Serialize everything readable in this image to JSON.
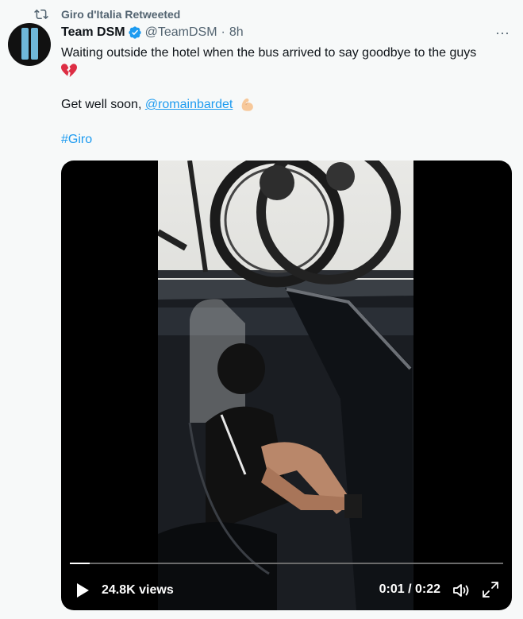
{
  "retweet": {
    "label": "Giro d'Italia Retweeted"
  },
  "tweet": {
    "name": "Team DSM",
    "handle": "@TeamDSM",
    "separator": "·",
    "time": "8h",
    "more_label": "···",
    "text_line1": "Waiting outside the hotel when the bus arrived to say goodbye to the guys",
    "text_line2_prefix": "Get well soon, ",
    "mention": "@romainbardet",
    "hashtag": "#Giro"
  },
  "video": {
    "views": "24.8K views",
    "time": "0:01 / 0:22",
    "progress": 0.045
  },
  "colors": {
    "link": "#1d9bf0",
    "verified": "#1d9bf0",
    "muted": "#536471",
    "background": "#f7f9f9"
  },
  "icons": {
    "retweet": "retweet-icon",
    "verified": "verified-badge-icon",
    "heart": "broken-heart-emoji",
    "muscle": "flexed-biceps-emoji",
    "play": "play-icon",
    "volume": "volume-icon",
    "fullscreen": "fullscreen-icon"
  }
}
